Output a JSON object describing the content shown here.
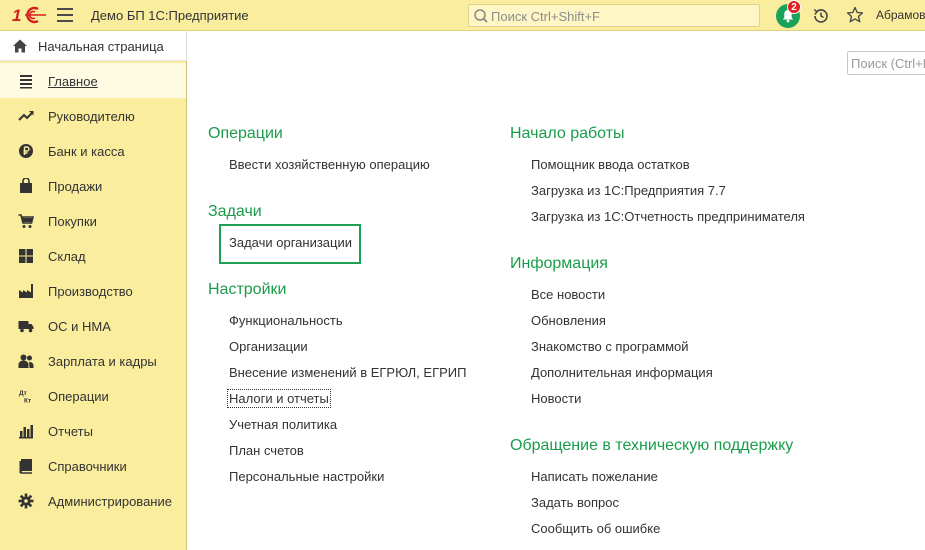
{
  "app": {
    "logo_text": "1С",
    "title": "Демо БП 1С:Предприятие",
    "search_placeholder": "Поиск Ctrl+Shift+F",
    "notifications_count": "2",
    "user": "Абрамов"
  },
  "home": {
    "label": "Начальная страница"
  },
  "sidebar": {
    "items": [
      {
        "label": "Главное",
        "icon": "list-icon",
        "active": true
      },
      {
        "label": "Руководителю",
        "icon": "trend-icon"
      },
      {
        "label": "Банк и касса",
        "icon": "ruble-icon"
      },
      {
        "label": "Продажи",
        "icon": "bag-icon"
      },
      {
        "label": "Покупки",
        "icon": "cart-icon"
      },
      {
        "label": "Склад",
        "icon": "warehouse-icon"
      },
      {
        "label": "Производство",
        "icon": "factory-icon"
      },
      {
        "label": "ОС и НМА",
        "icon": "truck-icon"
      },
      {
        "label": "Зарплата и кадры",
        "icon": "people-icon"
      },
      {
        "label": "Операции",
        "icon": "dt-kt-icon"
      },
      {
        "label": "Отчеты",
        "icon": "bar-chart-icon"
      },
      {
        "label": "Справочники",
        "icon": "book-icon"
      },
      {
        "label": "Администрирование",
        "icon": "gear-icon"
      }
    ]
  },
  "content": {
    "search_placeholder": "Поиск (Ctrl+F)",
    "left": {
      "operations": {
        "title": "Операции",
        "links": [
          "Ввести хозяйственную операцию"
        ]
      },
      "tasks": {
        "title": "Задачи",
        "links": [
          "Задачи организации"
        ]
      },
      "settings": {
        "title": "Настройки",
        "links": [
          "Функциональность",
          "Организации",
          "Внесение изменений в ЕГРЮЛ, ЕГРИП",
          "Налоги и отчеты",
          "Учетная политика",
          "План счетов",
          "Персональные настройки"
        ]
      }
    },
    "right": {
      "start": {
        "title": "Начало работы",
        "links": [
          "Помощник ввода остатков",
          "Загрузка из 1С:Предприятия 7.7",
          "Загрузка из 1С:Отчетность предпринимателя"
        ]
      },
      "info": {
        "title": "Информация",
        "links": [
          "Все новости",
          "Обновления",
          "Знакомство с программой",
          "Дополнительная информация",
          "Новости"
        ]
      },
      "support": {
        "title": "Обращение в техническую поддержку",
        "links": [
          "Написать пожелание",
          "Задать вопрос",
          "Сообщить об ошибке"
        ]
      }
    }
  },
  "colors": {
    "topbar": "#fbed9e",
    "accent_green": "#1b9c4b",
    "badge_red": "#e0201f"
  }
}
